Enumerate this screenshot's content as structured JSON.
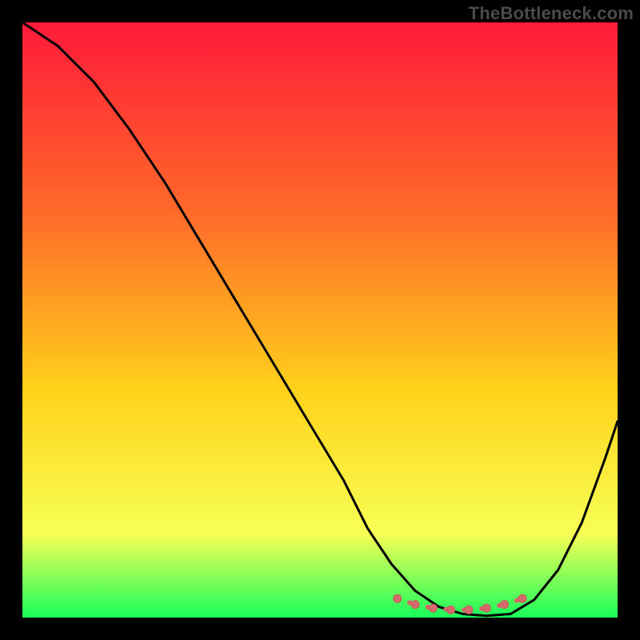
{
  "watermark": {
    "text": "TheBottleneck.com"
  },
  "colors": {
    "background": "#000000",
    "gradient_top": "#ff1a3a",
    "gradient_mid1": "#ff6a2a",
    "gradient_mid2": "#ffd21a",
    "gradient_mid3": "#f7ff55",
    "gradient_bottom": "#19ff5a",
    "curve": "#000000",
    "marker_fill": "#d46a6a",
    "marker_stroke": "#c95a5a"
  },
  "chart_data": {
    "type": "line",
    "title": "",
    "xlabel": "",
    "ylabel": "",
    "xlim": [
      0,
      100
    ],
    "ylim": [
      0,
      100
    ],
    "grid": false,
    "legend": false,
    "series": [
      {
        "name": "bottleneck-curve",
        "x": [
          0,
          6,
          12,
          18,
          24,
          30,
          36,
          42,
          48,
          54,
          58,
          62,
          66,
          70,
          74,
          78,
          82,
          86,
          90,
          94,
          98,
          100
        ],
        "values": [
          100,
          96,
          90,
          82,
          73,
          63,
          53,
          43,
          33,
          23,
          15,
          9,
          4.5,
          1.8,
          0.6,
          0.3,
          0.6,
          3,
          8,
          16,
          27,
          33
        ]
      }
    ],
    "annotations": [
      {
        "name": "flat-valley-markers",
        "kind": "dotted-segment",
        "x": [
          63,
          66,
          69,
          72,
          75,
          78,
          81,
          84
        ],
        "values": [
          3.2,
          2.2,
          1.6,
          1.3,
          1.3,
          1.6,
          2.2,
          3.2
        ]
      }
    ]
  }
}
